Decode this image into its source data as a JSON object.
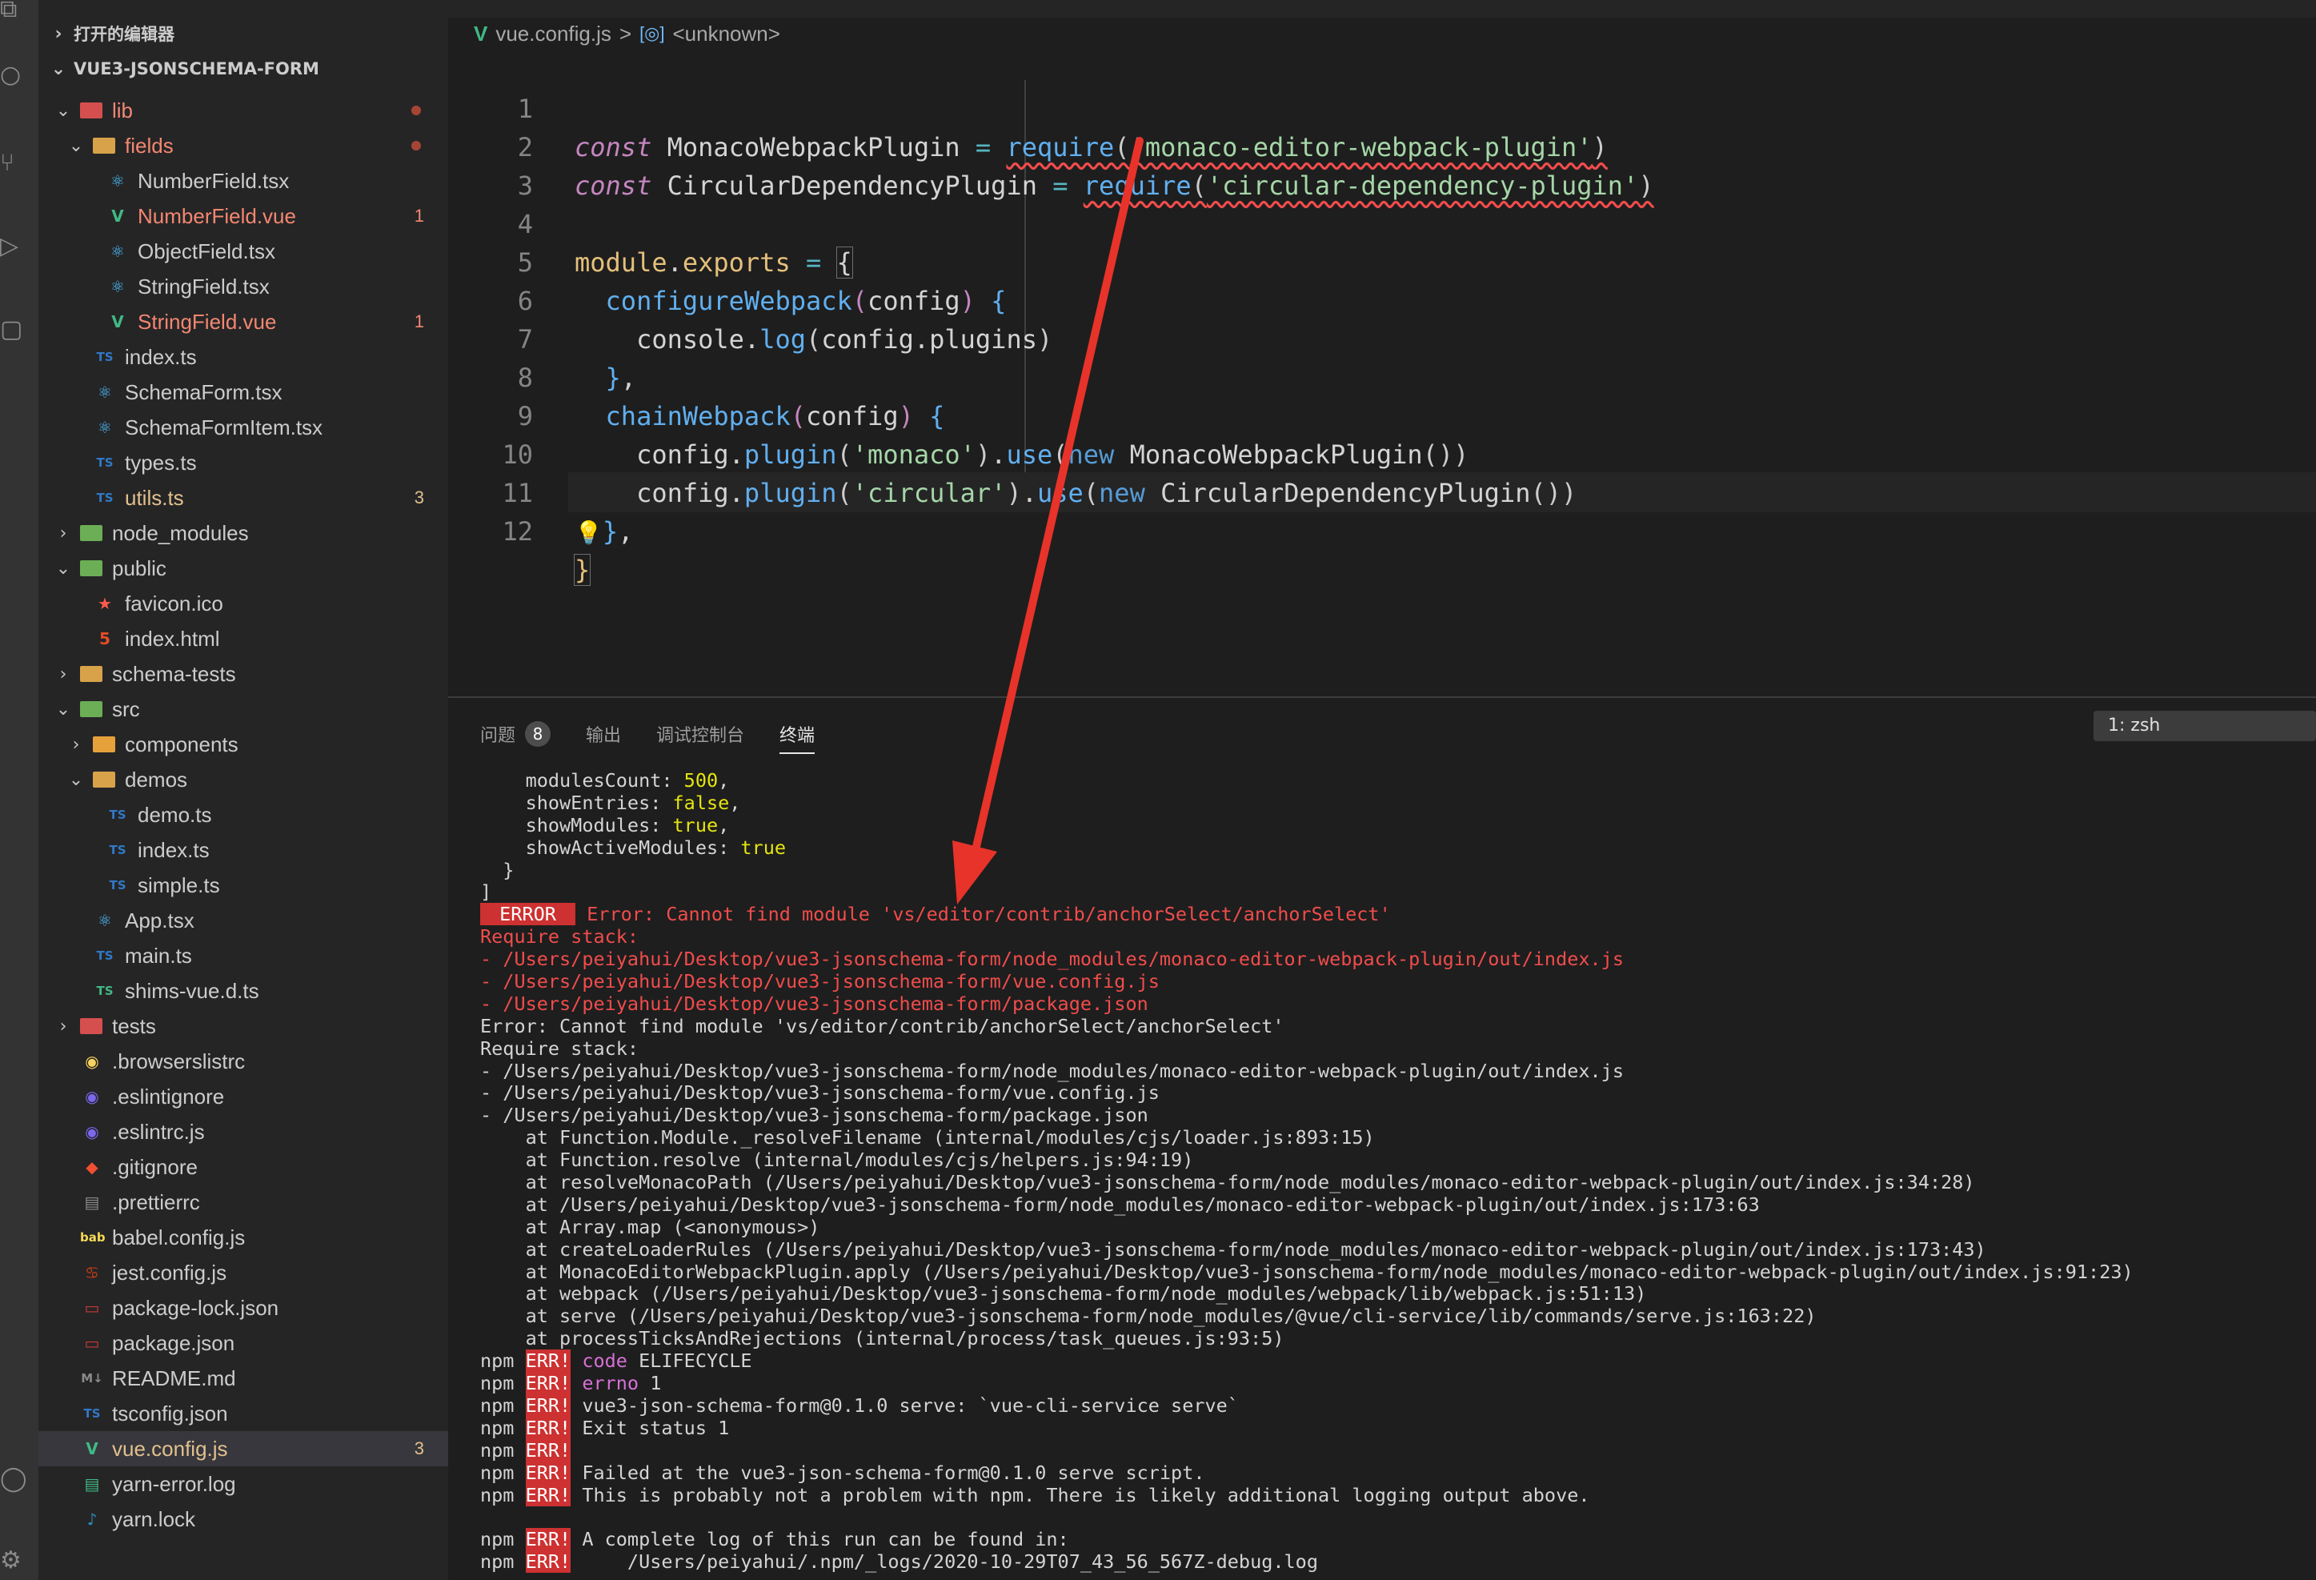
{
  "sidebar": {
    "open_editors": "打开的编辑器",
    "project": "VUE3-JSONSCHEMA-FORM",
    "items": [
      {
        "name": "lib",
        "indent": 1,
        "chev": "v",
        "kind": "folder-red",
        "status": "dot",
        "color": "err"
      },
      {
        "name": "fields",
        "indent": 2,
        "chev": "v",
        "kind": "folder",
        "status": "dot",
        "color": "err"
      },
      {
        "name": "NumberField.tsx",
        "indent": 3,
        "kind": "react",
        "color": "plain"
      },
      {
        "name": "NumberField.vue",
        "indent": 3,
        "kind": "vue",
        "badge": "1",
        "color": "err"
      },
      {
        "name": "ObjectField.tsx",
        "indent": 3,
        "kind": "react",
        "color": "plain"
      },
      {
        "name": "StringField.tsx",
        "indent": 3,
        "kind": "react",
        "color": "plain"
      },
      {
        "name": "StringField.vue",
        "indent": 3,
        "kind": "vue",
        "badge": "1",
        "color": "err"
      },
      {
        "name": "index.ts",
        "indent": 2,
        "kind": "ts",
        "color": "plain"
      },
      {
        "name": "SchemaForm.tsx",
        "indent": 2,
        "kind": "react",
        "color": "plain"
      },
      {
        "name": "SchemaFormItem.tsx",
        "indent": 2,
        "kind": "react",
        "color": "plain"
      },
      {
        "name": "types.ts",
        "indent": 2,
        "kind": "ts",
        "color": "plain"
      },
      {
        "name": "utils.ts",
        "indent": 2,
        "kind": "ts",
        "badge": "3",
        "color": "mod"
      },
      {
        "name": "node_modules",
        "indent": 1,
        "chev": ">",
        "kind": "folder-green",
        "color": "plain"
      },
      {
        "name": "public",
        "indent": 1,
        "chev": "v",
        "kind": "folder-green",
        "color": "plain"
      },
      {
        "name": "favicon.ico",
        "indent": 2,
        "kind": "star",
        "color": "plain"
      },
      {
        "name": "index.html",
        "indent": 2,
        "kind": "html",
        "color": "plain"
      },
      {
        "name": "schema-tests",
        "indent": 1,
        "chev": ">",
        "kind": "folder",
        "color": "plain"
      },
      {
        "name": "src",
        "indent": 1,
        "chev": "v",
        "kind": "folder-green",
        "color": "plain"
      },
      {
        "name": "components",
        "indent": 2,
        "chev": ">",
        "kind": "folder-orange",
        "color": "plain"
      },
      {
        "name": "demos",
        "indent": 2,
        "chev": "v",
        "kind": "folder",
        "color": "plain"
      },
      {
        "name": "demo.ts",
        "indent": 3,
        "kind": "ts",
        "color": "plain"
      },
      {
        "name": "index.ts",
        "indent": 3,
        "kind": "ts",
        "color": "plain"
      },
      {
        "name": "simple.ts",
        "indent": 3,
        "kind": "ts",
        "color": "plain"
      },
      {
        "name": "App.tsx",
        "indent": 2,
        "kind": "react",
        "color": "plain"
      },
      {
        "name": "main.ts",
        "indent": 2,
        "kind": "ts",
        "color": "plain"
      },
      {
        "name": "shims-vue.d.ts",
        "indent": 2,
        "kind": "ts-green",
        "color": "plain"
      },
      {
        "name": "tests",
        "indent": 1,
        "chev": ">",
        "kind": "folder-red",
        "color": "plain"
      },
      {
        "name": ".browserslistrc",
        "indent": 1,
        "kind": "ring-yellow",
        "color": "plain"
      },
      {
        "name": ".eslintignore",
        "indent": 1,
        "kind": "ring-purple",
        "color": "plain"
      },
      {
        "name": ".eslintrc.js",
        "indent": 1,
        "kind": "ring-purple",
        "color": "plain"
      },
      {
        "name": ".gitignore",
        "indent": 1,
        "kind": "git",
        "color": "plain"
      },
      {
        "name": ".prettierrc",
        "indent": 1,
        "kind": "prettier",
        "color": "plain"
      },
      {
        "name": "babel.config.js",
        "indent": 1,
        "kind": "babel",
        "color": "plain"
      },
      {
        "name": "jest.config.js",
        "indent": 1,
        "kind": "jest",
        "color": "plain"
      },
      {
        "name": "package-lock.json",
        "indent": 1,
        "kind": "npm",
        "color": "plain"
      },
      {
        "name": "package.json",
        "indent": 1,
        "kind": "npm",
        "color": "plain"
      },
      {
        "name": "README.md",
        "indent": 1,
        "kind": "md",
        "color": "plain"
      },
      {
        "name": "tsconfig.json",
        "indent": 1,
        "kind": "tsconfig",
        "color": "plain"
      },
      {
        "name": "vue.config.js",
        "indent": 1,
        "kind": "vue",
        "badge": "3",
        "color": "mod",
        "selected": true
      },
      {
        "name": "yarn-error.log",
        "indent": 1,
        "kind": "log",
        "color": "plain"
      },
      {
        "name": "yarn.lock",
        "indent": 1,
        "kind": "yarn",
        "color": "plain"
      }
    ]
  },
  "breadcrumb": {
    "file": "vue.config.js",
    "separator": ">",
    "symbol": "<unknown>"
  },
  "editor": {
    "line_numbers": [
      "1",
      "2",
      "3",
      "4",
      "5",
      "6",
      "7",
      "8",
      "9",
      "10",
      "11",
      "12"
    ]
  },
  "panel": {
    "tabs": [
      {
        "label": "问题",
        "badge": "8"
      },
      {
        "label": "输出"
      },
      {
        "label": "调试控制台"
      },
      {
        "label": "终端",
        "active": true
      }
    ],
    "terminal_select": "1: zsh"
  },
  "terminal": {
    "lines": [
      [
        {
          "t": "    modulesCount: "
        },
        {
          "t": "500",
          "c": "yel"
        },
        {
          "t": ","
        }
      ],
      [
        {
          "t": "    showEntries: "
        },
        {
          "t": "false",
          "c": "yel"
        },
        {
          "t": ","
        }
      ],
      [
        {
          "t": "    showModules: "
        },
        {
          "t": "true",
          "c": "yel"
        },
        {
          "t": ","
        }
      ],
      [
        {
          "t": "    showActiveModules: "
        },
        {
          "t": "true",
          "c": "yel"
        }
      ],
      [
        {
          "t": "  }"
        }
      ],
      [
        {
          "t": "]"
        }
      ],
      [
        {
          "t": " ERROR ",
          "c": "errtag"
        },
        {
          "t": " Error: Cannot find module 'vs/editor/contrib/anchorSelect/anchorSelect'",
          "c": "red"
        }
      ],
      [
        {
          "t": "Require stack:",
          "c": "red"
        }
      ],
      [
        {
          "t": "- /Users/peiyahui/Desktop/vue3-jsonschema-form/node_modules/monaco-editor-webpack-plugin/out/index.js",
          "c": "red"
        }
      ],
      [
        {
          "t": "- /Users/peiyahui/Desktop/vue3-jsonschema-form/vue.config.js",
          "c": "red"
        }
      ],
      [
        {
          "t": "- /Users/peiyahui/Desktop/vue3-jsonschema-form/package.json",
          "c": "red"
        }
      ],
      [
        {
          "t": "Error: Cannot find module 'vs/editor/contrib/anchorSelect/anchorSelect'"
        }
      ],
      [
        {
          "t": "Require stack:"
        }
      ],
      [
        {
          "t": "- /Users/peiyahui/Desktop/vue3-jsonschema-form/node_modules/monaco-editor-webpack-plugin/out/index.js"
        }
      ],
      [
        {
          "t": "- /Users/peiyahui/Desktop/vue3-jsonschema-form/vue.config.js"
        }
      ],
      [
        {
          "t": "- /Users/peiyahui/Desktop/vue3-jsonschema-form/package.json"
        }
      ],
      [
        {
          "t": "    at Function.Module._resolveFilename (internal/modules/cjs/loader.js:893:15)"
        }
      ],
      [
        {
          "t": "    at Function.resolve (internal/modules/cjs/helpers.js:94:19)"
        }
      ],
      [
        {
          "t": "    at resolveMonacoPath (/Users/peiyahui/Desktop/vue3-jsonschema-form/node_modules/monaco-editor-webpack-plugin/out/index.js:34:28)"
        }
      ],
      [
        {
          "t": "    at /Users/peiyahui/Desktop/vue3-jsonschema-form/node_modules/monaco-editor-webpack-plugin/out/index.js:173:63"
        }
      ],
      [
        {
          "t": "    at Array.map (<anonymous>)"
        }
      ],
      [
        {
          "t": "    at createLoaderRules (/Users/peiyahui/Desktop/vue3-jsonschema-form/node_modules/monaco-editor-webpack-plugin/out/index.js:173:43)"
        }
      ],
      [
        {
          "t": "    at MonacoEditorWebpackPlugin.apply (/Users/peiyahui/Desktop/vue3-jsonschema-form/node_modules/monaco-editor-webpack-plugin/out/index.js:91:23)"
        }
      ],
      [
        {
          "t": "    at webpack (/Users/peiyahui/Desktop/vue3-jsonschema-form/node_modules/webpack/lib/webpack.js:51:13)"
        }
      ],
      [
        {
          "t": "    at serve (/Users/peiyahui/Desktop/vue3-jsonschema-form/node_modules/@vue/cli-service/lib/commands/serve.js:163:22)"
        }
      ],
      [
        {
          "t": "    at processTicksAndRejections (internal/process/task_queues.js:93:5)"
        }
      ],
      [
        {
          "t": "npm "
        },
        {
          "t": "ERR!",
          "c": "npmerr"
        },
        {
          "t": " "
        },
        {
          "t": "code",
          "c": "mag"
        },
        {
          "t": " ELIFECYCLE"
        }
      ],
      [
        {
          "t": "npm "
        },
        {
          "t": "ERR!",
          "c": "npmerr"
        },
        {
          "t": " "
        },
        {
          "t": "errno",
          "c": "mag"
        },
        {
          "t": " 1"
        }
      ],
      [
        {
          "t": "npm "
        },
        {
          "t": "ERR!",
          "c": "npmerr"
        },
        {
          "t": " vue3-json-schema-form@0.1.0 serve: `vue-cli-service serve`"
        }
      ],
      [
        {
          "t": "npm "
        },
        {
          "t": "ERR!",
          "c": "npmerr"
        },
        {
          "t": " Exit status 1"
        }
      ],
      [
        {
          "t": "npm "
        },
        {
          "t": "ERR!",
          "c": "npmerr"
        }
      ],
      [
        {
          "t": "npm "
        },
        {
          "t": "ERR!",
          "c": "npmerr"
        },
        {
          "t": " Failed at the vue3-json-schema-form@0.1.0 serve script."
        }
      ],
      [
        {
          "t": "npm "
        },
        {
          "t": "ERR!",
          "c": "npmerr"
        },
        {
          "t": " This is probably not a problem with npm. There is likely additional logging output above."
        }
      ],
      [
        {
          "t": ""
        }
      ],
      [
        {
          "t": "npm "
        },
        {
          "t": "ERR!",
          "c": "npmerr"
        },
        {
          "t": " A complete log of this run can be found in:"
        }
      ],
      [
        {
          "t": "npm "
        },
        {
          "t": "ERR!",
          "c": "npmerr"
        },
        {
          "t": "     /Users/peiyahui/.npm/_logs/2020-10-29T07_43_56_567Z-debug.log"
        }
      ]
    ]
  },
  "colors": {
    "annotation_arrow": "#e8332a",
    "accent": "#007acc"
  }
}
